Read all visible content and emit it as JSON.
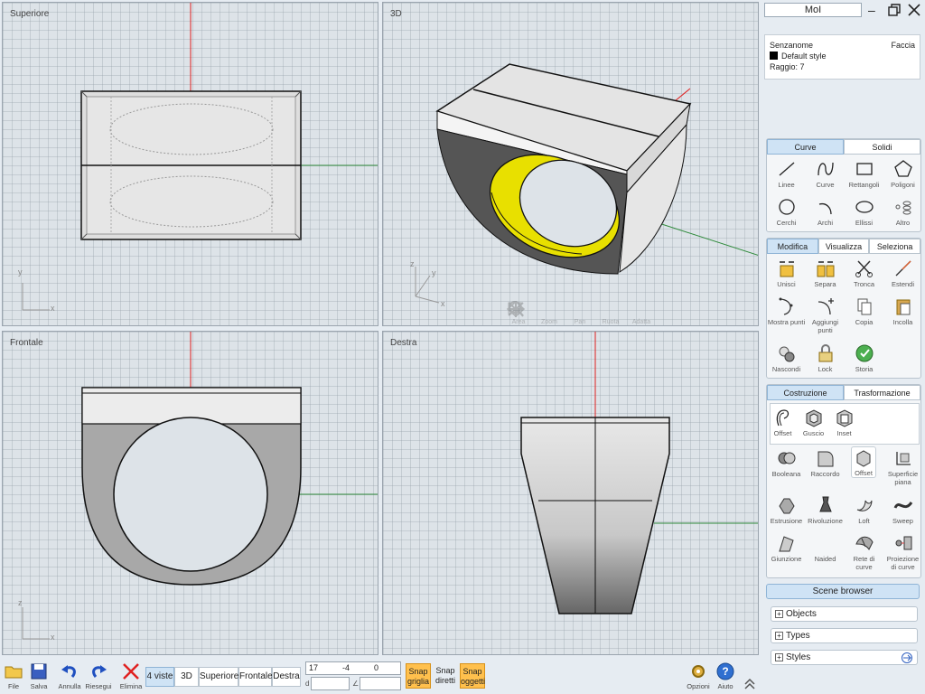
{
  "app_title": "MoI",
  "viewports": {
    "top": "Superiore",
    "persp": "3D",
    "front": "Frontale",
    "right": "Destra"
  },
  "axis_labels": {
    "x": "x",
    "y": "y",
    "z": "z"
  },
  "nav_tools": [
    "Area",
    "Zoom",
    "Pan",
    "Ruota",
    "Adatta"
  ],
  "properties": {
    "name": "Senzanome",
    "type": "Faccia",
    "style": "Default style",
    "radius": "Raggio: 7"
  },
  "panels": {
    "draw": {
      "tabs": [
        "Curve",
        "Solidi"
      ],
      "tools": [
        "Linee",
        "Curve",
        "Rettangoli",
        "Poligoni",
        "Cerchi",
        "Archi",
        "Ellissi",
        "Altro"
      ]
    },
    "edit": {
      "tabs": [
        "Modifica",
        "Visualizza",
        "Seleziona"
      ],
      "tools": [
        "Unisci",
        "Separa",
        "Tronca",
        "Estendi",
        "Mostra punti",
        "Aggiungi punti",
        "Copia",
        "Incolla",
        "Nascondi",
        "Lock",
        "Storia"
      ]
    },
    "construct": {
      "tabs": [
        "Costruzione",
        "Trasformazione"
      ],
      "sub_tools": [
        "Offset",
        "Guscio",
        "Inset"
      ],
      "tools": [
        "Booleana",
        "Raccordo",
        "Offset",
        "Superficie piana",
        "Estrusione",
        "Rivoluzione",
        "Loft",
        "Sweep",
        "Giunzione",
        "Naided",
        "Rete di curve",
        "Proiezione di curve"
      ]
    }
  },
  "scene_browser": {
    "title": "Scene browser",
    "items": [
      "Objects",
      "Types",
      "Styles"
    ]
  },
  "toolbar": {
    "file": "File",
    "save": "Salva",
    "undo": "Annulla",
    "redo": "Riesegui",
    "delete": "Elimina",
    "views": [
      "4 viste",
      "3D",
      "Superiore",
      "Frontale",
      "Destra"
    ],
    "coords": {
      "x": "17",
      "y": "-4",
      "z": "0",
      "d_label": "d",
      "angle_label": "∠",
      "d": "",
      "angle": ""
    },
    "snaps": [
      "Snap griglia",
      "Snap diretti",
      "Snap oggetti"
    ],
    "options": "Opzioni",
    "help": "Aiuto"
  },
  "colors": {
    "accent_tab": "#cfe3f5",
    "snap_on": "#ffc04d",
    "axis_x": "#2e8a3a",
    "axis_y": "#e02020",
    "inner_band": "#e8e000"
  }
}
